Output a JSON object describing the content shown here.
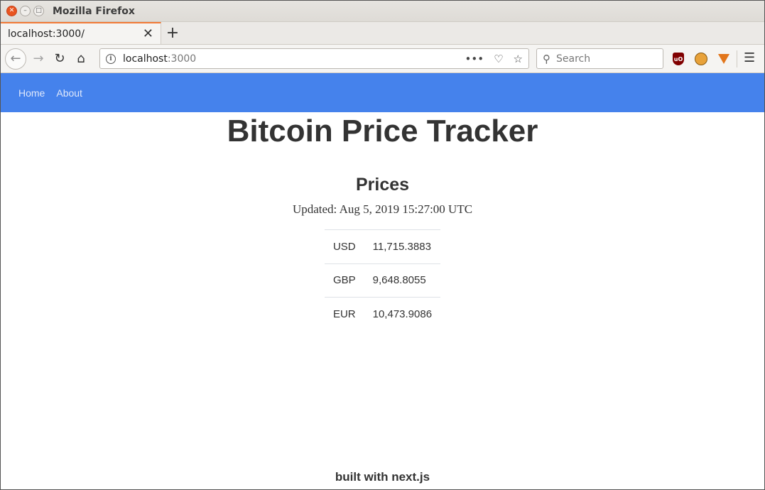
{
  "window": {
    "title": "Mozilla Firefox",
    "close_glyph": "✕",
    "min_glyph": "–",
    "max_glyph": "□"
  },
  "tab": {
    "label": "localhost:3000/",
    "close_glyph": "✕",
    "new_tab_glyph": "+"
  },
  "nav": {
    "back_glyph": "←",
    "forward_glyph": "→",
    "reload_glyph": "↻",
    "home_glyph": "⌂"
  },
  "urlbar": {
    "host": "localhost",
    "port": ":3000",
    "more_glyph": "•••",
    "pocket_glyph": "♡",
    "bookmark_glyph": "☆"
  },
  "search": {
    "placeholder": "Search",
    "icon_glyph": "⚲"
  },
  "extensions": {
    "ublock_label": "uO"
  },
  "menu_glyph": "☰",
  "site": {
    "nav_links": [
      "Home",
      "About"
    ],
    "title": "Bitcoin Price Tracker",
    "section_title": "Prices",
    "updated": "Updated: Aug 5, 2019 15:27:00 UTC",
    "prices": [
      {
        "currency": "USD",
        "value": "11,715.3883"
      },
      {
        "currency": "GBP",
        "value": "9,648.8055"
      },
      {
        "currency": "EUR",
        "value": "10,473.9086"
      }
    ],
    "footer": "built with next.js"
  },
  "colors": {
    "site_nav_bg": "#4582ec",
    "tab_accent": "#f27a36",
    "close_button": "#e95420"
  }
}
